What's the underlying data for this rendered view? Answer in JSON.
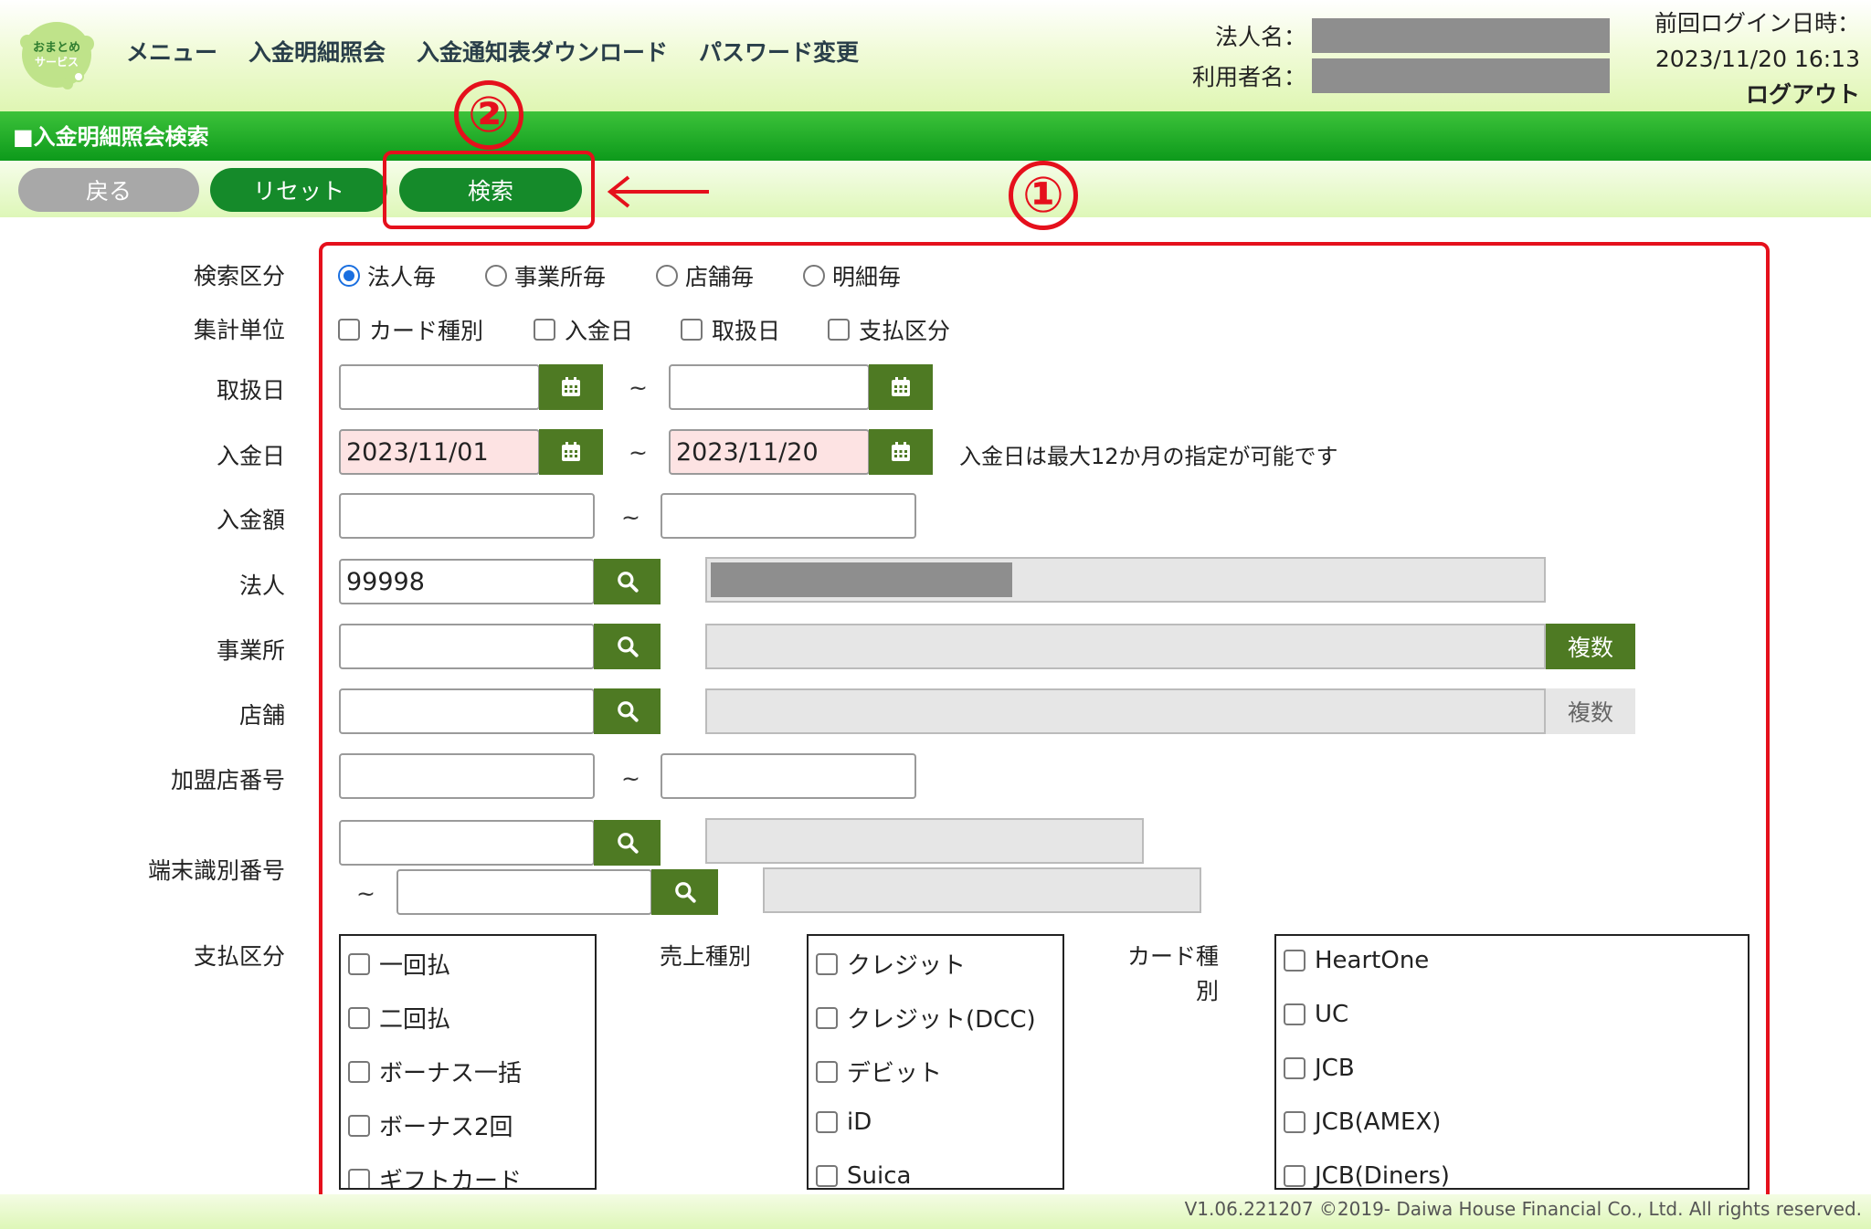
{
  "header": {
    "logo_text_1": "おまとめ",
    "logo_text_2": "サービス",
    "nav": [
      "メニュー",
      "入金明細照会",
      "入金通知表ダウンロード",
      "パスワード変更"
    ],
    "corp_label": "法人名：",
    "user_label": "利用者名：",
    "last_login_label": "前回ログイン日時：",
    "last_login_value": "2023/11/20 16:13",
    "logout": "ログアウト"
  },
  "titlebar": {
    "title": "■入金明細照会検索"
  },
  "buttons": {
    "back": "戻る",
    "reset": "リセット",
    "search": "検索"
  },
  "annotations": {
    "one": "①",
    "two": "②",
    "color": "#e5101c"
  },
  "form": {
    "search_type": {
      "label": "検索区分",
      "options": [
        "法人毎",
        "事業所毎",
        "店舗毎",
        "明細毎"
      ],
      "selected": "法人毎"
    },
    "aggregation": {
      "label": "集計単位",
      "options": [
        "カード種別",
        "入金日",
        "取扱日",
        "支払区分"
      ]
    },
    "handling_date": {
      "label": "取扱日",
      "from": "",
      "to": "",
      "tilde": "~"
    },
    "deposit_date": {
      "label": "入金日",
      "from": "2023/11/01",
      "to": "2023/11/20",
      "tilde": "~",
      "hint": "入金日は最大12か月の指定が可能です"
    },
    "deposit_amount": {
      "label": "入金額",
      "from": "",
      "to": "",
      "tilde": "~"
    },
    "corporation": {
      "label": "法人",
      "value": "99998"
    },
    "office": {
      "label": "事業所",
      "value": "",
      "multi": "複数"
    },
    "store": {
      "label": "店舗",
      "value": "",
      "multi": "複数"
    },
    "member_no": {
      "label": "加盟店番号",
      "from": "",
      "to": "",
      "tilde": "~"
    },
    "terminal": {
      "label": "端末識別番号",
      "from": "",
      "to": "",
      "tilde": "~"
    },
    "payment_type": {
      "label": "支払区分",
      "options": [
        "一回払",
        "二回払",
        "ボーナス一括",
        "ボーナス2回",
        "ギフトカード"
      ]
    },
    "sales_type": {
      "label": "売上種別",
      "options": [
        "クレジット",
        "クレジット(DCC)",
        "デビット",
        "iD",
        "Suica"
      ]
    },
    "card_type": {
      "label_1": "カード種",
      "label_2": "別",
      "options": [
        "HeartOne",
        "UC",
        "JCB",
        "JCB(AMEX)",
        "JCB(Diners)"
      ]
    }
  },
  "footer": {
    "text": "V1.06.221207 ©2019- Daiwa House Financial Co., Ltd. All rights reserved."
  },
  "colors": {
    "accent_green": "#158a2a",
    "button_green": "#4e7a23",
    "title_green": "#0d9a1b"
  }
}
